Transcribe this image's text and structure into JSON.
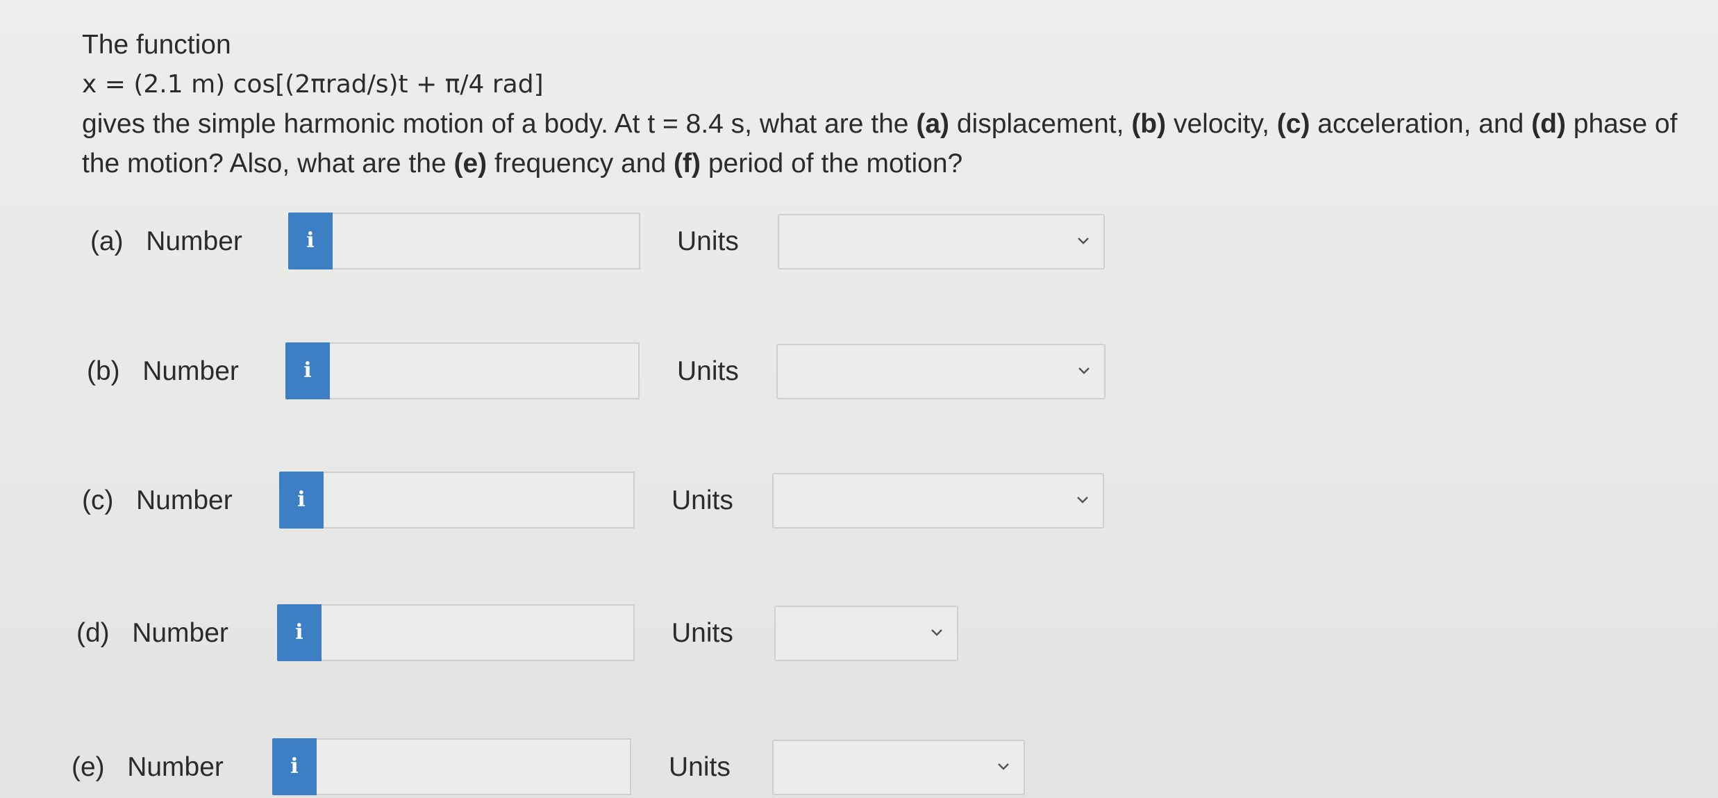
{
  "question": {
    "intro": "The function",
    "equation": "x = (2.1 m) cos[(2πrad/s)t + π/4 rad]",
    "body_pre": "gives the simple harmonic motion of a body. At t = 8.4 s, what are the ",
    "a": "(a)",
    "a_text": " displacement, ",
    "b": "(b)",
    "b_text": " velocity, ",
    "c": "(c)",
    "c_text": " acceleration, and ",
    "d": "(d)",
    "d_text": " phase of the motion? Also, what are the ",
    "e": "(e)",
    "e_text": " frequency and ",
    "f": "(f)",
    "f_text": " period of the motion?"
  },
  "info_icon": "i",
  "rows": [
    {
      "part": "(a)",
      "label": "Number",
      "value": "",
      "units_label": "Units",
      "units_value": ""
    },
    {
      "part": "(b)",
      "label": "Number",
      "value": "",
      "units_label": "Units",
      "units_value": ""
    },
    {
      "part": "(c)",
      "label": "Number",
      "value": "",
      "units_label": "Units",
      "units_value": ""
    },
    {
      "part": "(d)",
      "label": "Number",
      "value": "",
      "units_label": "Units",
      "units_value": ""
    },
    {
      "part": "(e)",
      "label": "Number",
      "value": "",
      "units_label": "Units",
      "units_value": ""
    }
  ],
  "icons": {
    "info": "info-icon",
    "dropdown": "chevron-down-icon"
  },
  "colors": {
    "info_button": "#3d7fc4",
    "background": "#ebebe9",
    "border": "#cfcfcd"
  }
}
